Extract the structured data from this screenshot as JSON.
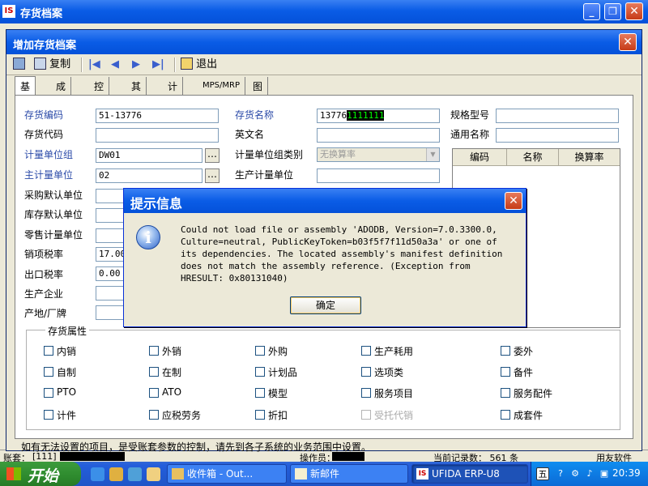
{
  "outer": {
    "title": "存货档案",
    "logo": "IS",
    "bottom_left_label": "账套：",
    "bottom_left_value": "[111]",
    "bottom_mid_label": "操作员：",
    "bottom_count": "当前记录数： 561 条",
    "bottom_right": "用友软件"
  },
  "dialog": {
    "title": "增加存货档案",
    "toolbar": {
      "copy_label": "复制",
      "exit_label": "退出"
    },
    "tabs": [
      "基本",
      "成本",
      "控制",
      "其它",
      "计划",
      "MPS/MRP",
      "图片"
    ],
    "fields": {
      "inventory_code": {
        "label": "存货编码",
        "value": "51-13776"
      },
      "inventory_name": {
        "label": "存货名称",
        "value_plain": "13776",
        "value_selected": "1111111"
      },
      "spec_model": {
        "label": "规格型号",
        "value": ""
      },
      "inventory_alias": {
        "label": "存货代码",
        "value": ""
      },
      "english_name": {
        "label": "英文名",
        "value": ""
      },
      "common_name": {
        "label": "通用名称",
        "value": ""
      },
      "uom_group": {
        "label": "计量单位组",
        "value": "DW01"
      },
      "uom_group_type": {
        "label": "计量单位组类别",
        "value": "无换算率"
      },
      "main_uom": {
        "label": "主计量单位",
        "value": "02"
      },
      "production_uom": {
        "label": "生产计量单位",
        "value": ""
      },
      "purchase_uom": {
        "label": "采购默认单位",
        "value": ""
      },
      "stock_uom": {
        "label": "库存默认单位",
        "value": ""
      },
      "retail_uom": {
        "label": "零售计量单位",
        "value": ""
      },
      "sales_tax": {
        "label": "销项税率",
        "value": "17.00"
      },
      "export_tax": {
        "label": "出口税率",
        "value": "0.00"
      },
      "manufacturer": {
        "label": "生产企业",
        "value": ""
      },
      "origin": {
        "label": "产地/厂牌",
        "value": ""
      }
    },
    "conversion_table": {
      "headers": [
        "编码",
        "名称",
        "换算率"
      ]
    },
    "attributes": {
      "legend": "存货属性",
      "items": [
        {
          "label": "内销",
          "disabled": false
        },
        {
          "label": "外销",
          "disabled": false
        },
        {
          "label": "外购",
          "disabled": false
        },
        {
          "label": "生产耗用",
          "disabled": false
        },
        {
          "label": "委外",
          "disabled": false
        },
        {
          "label": "自制",
          "disabled": false
        },
        {
          "label": "在制",
          "disabled": false
        },
        {
          "label": "计划品",
          "disabled": false
        },
        {
          "label": "选项类",
          "disabled": false
        },
        {
          "label": "备件",
          "disabled": false
        },
        {
          "label": "PTO",
          "disabled": false
        },
        {
          "label": "ATO",
          "disabled": false
        },
        {
          "label": "模型",
          "disabled": false
        },
        {
          "label": "服务项目",
          "disabled": false
        },
        {
          "label": "服务配件",
          "disabled": false
        },
        {
          "label": "计件",
          "disabled": false
        },
        {
          "label": "应税劳务",
          "disabled": false
        },
        {
          "label": "折扣",
          "disabled": false
        },
        {
          "label": "受托代销",
          "disabled": true
        },
        {
          "label": "成套件",
          "disabled": false
        }
      ]
    },
    "status_text": "如有无法设置的项目，是受账套参数的控制，请先到各子系统的业务范围中设置。"
  },
  "message_box": {
    "title": "提示信息",
    "icon": "info-icon",
    "text": "Could not load file or assembly 'ADODB, Version=7.0.3300.0,\nCulture=neutral, PublicKeyToken=b03f5f7f11d50a3a' or one of\nits dependencies. The located assembly's manifest definition\ndoes not match the assembly reference. (Exception from\nHRESULT: 0x80131040)",
    "ok_label": "确定"
  },
  "taskbar": {
    "start_label": "开始",
    "tasks": [
      {
        "label": "收件箱 - Out...",
        "active": false
      },
      {
        "label": "新邮件",
        "active": false
      },
      {
        "label": "UFIDA ERP-U8",
        "active": true
      }
    ],
    "ime_label": "五",
    "clock": "20:39"
  },
  "colors": {
    "xp_title_blue": "#0a5ce6",
    "dialog_face": "#ece9d8",
    "label_blue": "#2b4aa8",
    "close_red": "#c63b17",
    "taskbar_blue": "#245edb",
    "start_green": "#2e8b2e"
  }
}
